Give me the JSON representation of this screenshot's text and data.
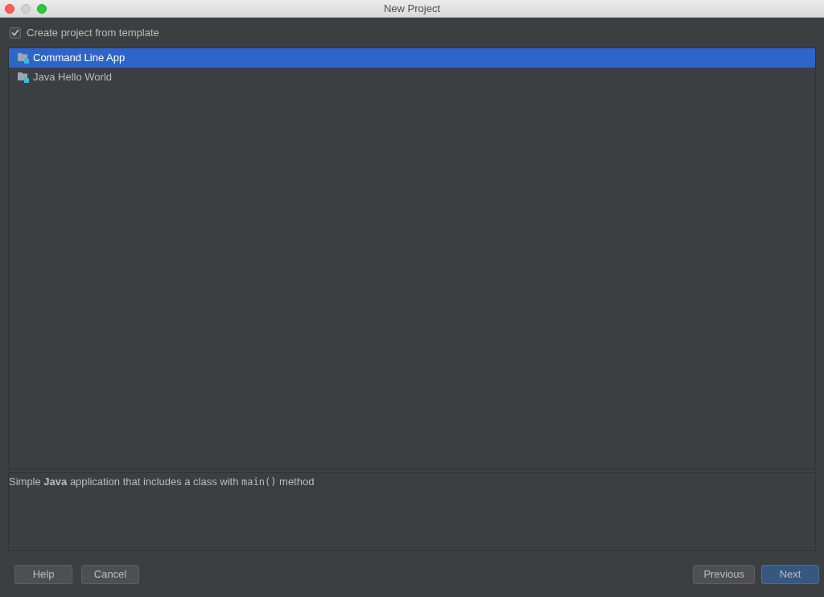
{
  "window": {
    "title": "New Project"
  },
  "template_option": {
    "label": "Create project from template",
    "checked": true
  },
  "templates": [
    {
      "label": "Command Line App",
      "selected": true
    },
    {
      "label": "Java Hello World",
      "selected": false
    }
  ],
  "description": [
    {
      "kind": "text",
      "text": "Simple "
    },
    {
      "kind": "bold",
      "text": "Java"
    },
    {
      "kind": "text",
      "text": " application that includes a class with "
    },
    {
      "kind": "code",
      "text": "main()"
    },
    {
      "kind": "text",
      "text": " method"
    }
  ],
  "left_buttons": [
    {
      "label": "Help",
      "kind": "normal"
    },
    {
      "label": "Cancel",
      "kind": "normal"
    }
  ],
  "right_buttons": [
    {
      "label": "Previous",
      "kind": "normal"
    },
    {
      "label": "Next",
      "kind": "primary"
    }
  ]
}
